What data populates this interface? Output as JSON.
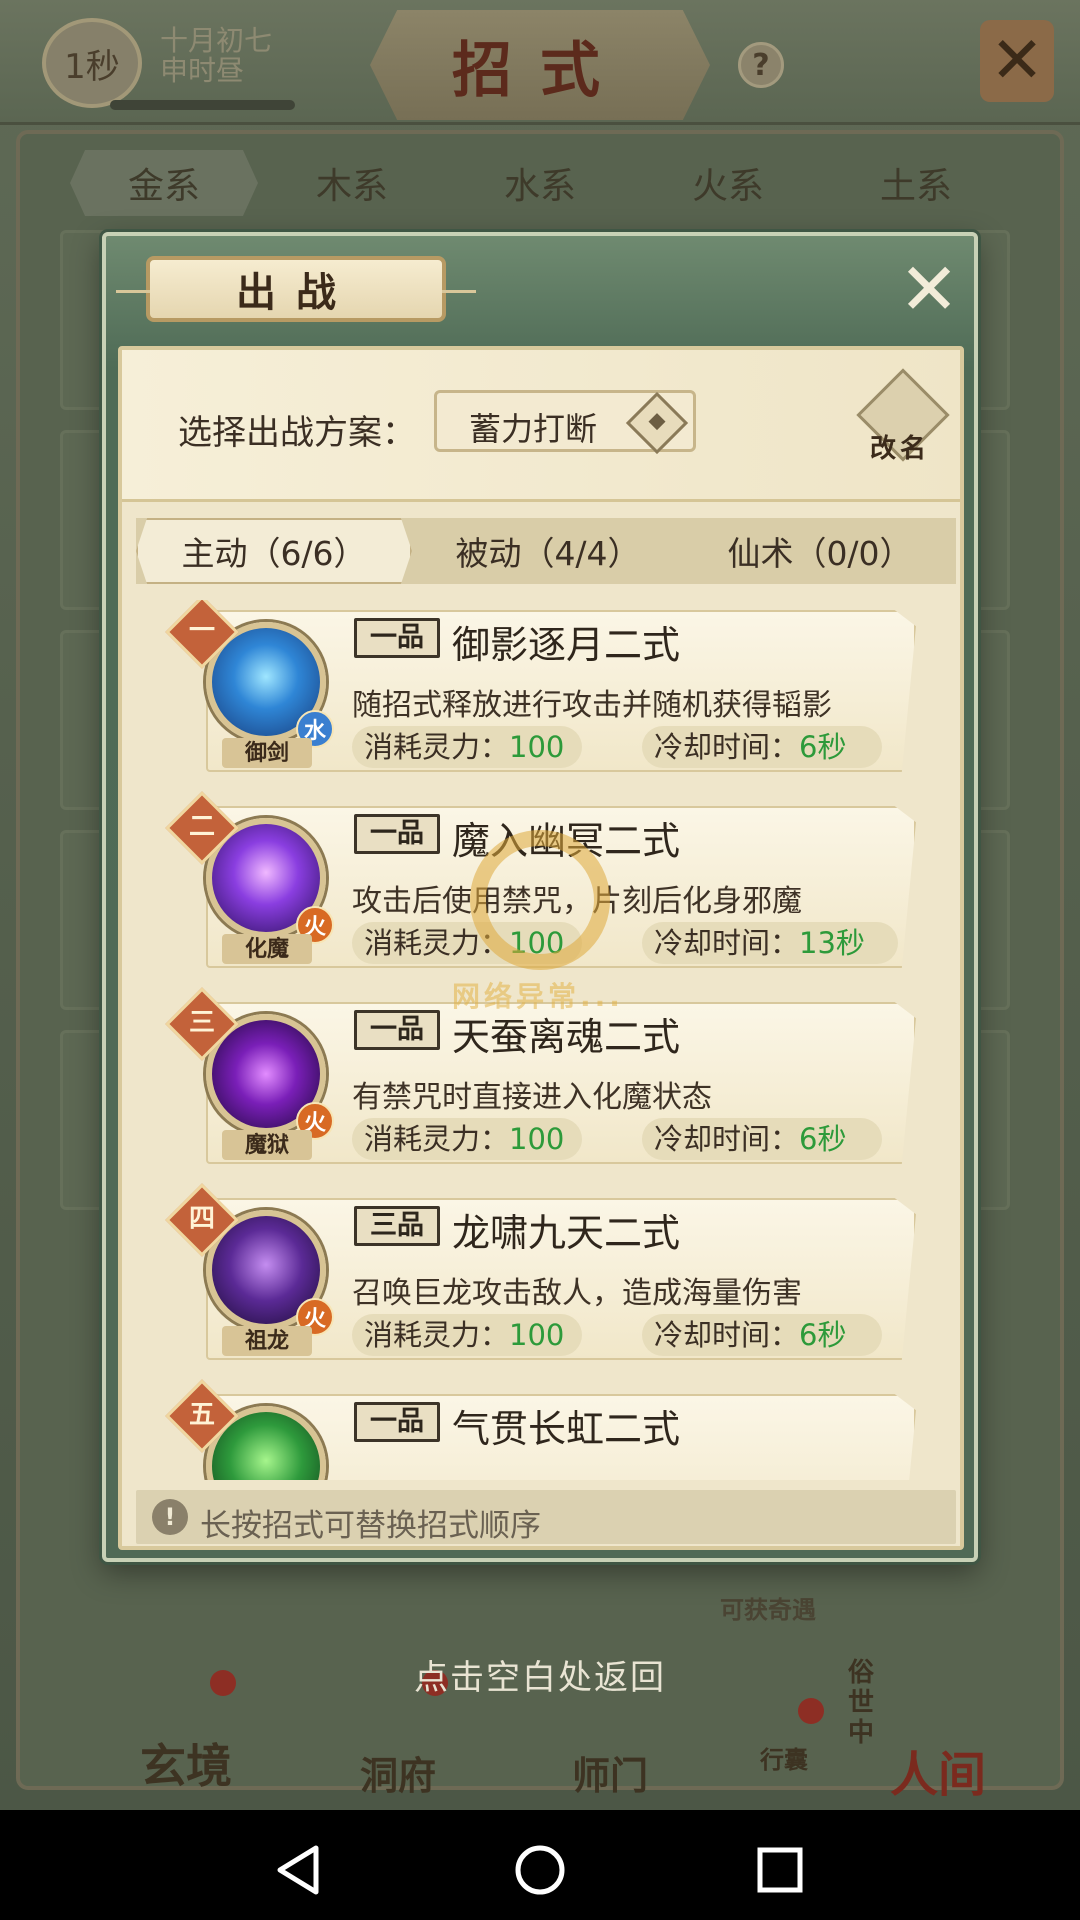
{
  "background": {
    "timer": "1秒",
    "date_line1": "十月初七",
    "date_line2": "申时昼",
    "header_title": "招式",
    "help": "?",
    "element_tabs": [
      "金系",
      "木系",
      "水系",
      "火系",
      "土系"
    ],
    "bottom_nav": {
      "xuanjing": "玄境",
      "dongfu": "洞府",
      "shimen": "师门",
      "xingnang": "行囊",
      "renjian": "人间",
      "sushi": "俗世中",
      "event_hint": "可获奇遇"
    },
    "return_hint": "点击空白处返回"
  },
  "modal": {
    "title": "出战",
    "close": "✕",
    "plan_label": "选择出战方案：",
    "plan_value": "蓄力打断",
    "rename": "改名",
    "tabs": [
      {
        "label": "主动（6/6）",
        "active": true
      },
      {
        "label": "被动（4/4）",
        "active": false
      },
      {
        "label": "仙术（0/0）",
        "active": false
      }
    ],
    "cost_label": "消耗灵力：",
    "cd_label": "冷却时间：",
    "skills": [
      {
        "rank": "一",
        "grade": "一品",
        "name": "御影逐月二式",
        "desc": "随招式释放进行攻击并随机获得韬影",
        "icon_name": "御剑",
        "element": "水",
        "cost": "100",
        "cd": "6秒",
        "color": "c-blue"
      },
      {
        "rank": "二",
        "grade": "一品",
        "name": "魔入幽冥二式",
        "desc": "攻击后使用禁咒，片刻后化身邪魔",
        "icon_name": "化魔",
        "element": "火",
        "cost": "100",
        "cd": "13秒",
        "color": "c-purple"
      },
      {
        "rank": "三",
        "grade": "一品",
        "name": "天蚕离魂二式",
        "desc": "有禁咒时直接进入化魔状态",
        "icon_name": "魔狱",
        "element": "火",
        "cost": "100",
        "cd": "6秒",
        "color": "c-violet"
      },
      {
        "rank": "四",
        "grade": "三品",
        "name": "龙啸九天二式",
        "desc": "召唤巨龙攻击敌人，造成海量伤害",
        "icon_name": "祖龙",
        "element": "火",
        "cost": "100",
        "cd": "6秒",
        "color": "c-dark"
      },
      {
        "rank": "五",
        "grade": "一品",
        "name": "气贯长虹二式",
        "desc": "",
        "icon_name": "",
        "element": "",
        "cost": "",
        "cd": "",
        "color": "c-green"
      }
    ],
    "tip_icon": "!",
    "tip": "长按招式可替换招式顺序",
    "loading": "网络异常..."
  },
  "colors": {
    "modal_green": "#506a56",
    "parchment": "#efe6cb",
    "rank_orange": "#c3623a",
    "value_green": "#2d9a3a"
  }
}
